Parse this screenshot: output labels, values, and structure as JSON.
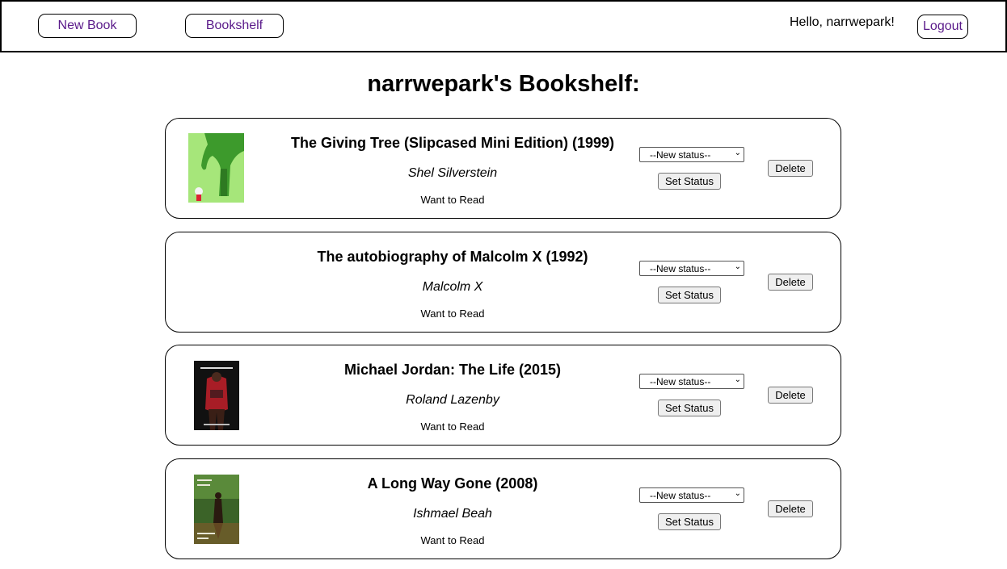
{
  "nav": {
    "new_book": "New Book",
    "bookshelf": "Bookshelf",
    "greeting": "Hello, narrwepark!",
    "logout": "Logout"
  },
  "page_title": "narrwepark's Bookshelf:",
  "books": [
    {
      "title": "The Giving Tree (Slipcased Mini Edition) (1999)",
      "author": "Shel Silverstein",
      "status": "Want to Read",
      "select_placeholder": "--New status--",
      "set_label": "Set Status",
      "delete_label": "Delete",
      "cover_colors": [
        "#9be26a",
        "#3e9a2c"
      ]
    },
    {
      "title": "The autobiography of Malcolm X (1992)",
      "author": "Malcolm X",
      "status": "Want to Read",
      "select_placeholder": "--New status--",
      "set_label": "Set Status",
      "delete_label": "Delete"
    },
    {
      "title": "Michael Jordan: The Life (2015)",
      "author": "Roland Lazenby",
      "status": "Want to Read",
      "select_placeholder": "--New status--",
      "set_label": "Set Status",
      "delete_label": "Delete",
      "cover_colors": [
        "#121212",
        "#b3202a"
      ]
    },
    {
      "title": "A Long Way Gone (2008)",
      "author": "Ishmael Beah",
      "status": "Want to Read",
      "select_placeholder": "--New status--",
      "set_label": "Set Status",
      "delete_label": "Delete",
      "cover_colors": [
        "#3f6b2a",
        "#7a5a2a"
      ]
    }
  ],
  "colors": {
    "nav_link": "#5a1a8a"
  }
}
